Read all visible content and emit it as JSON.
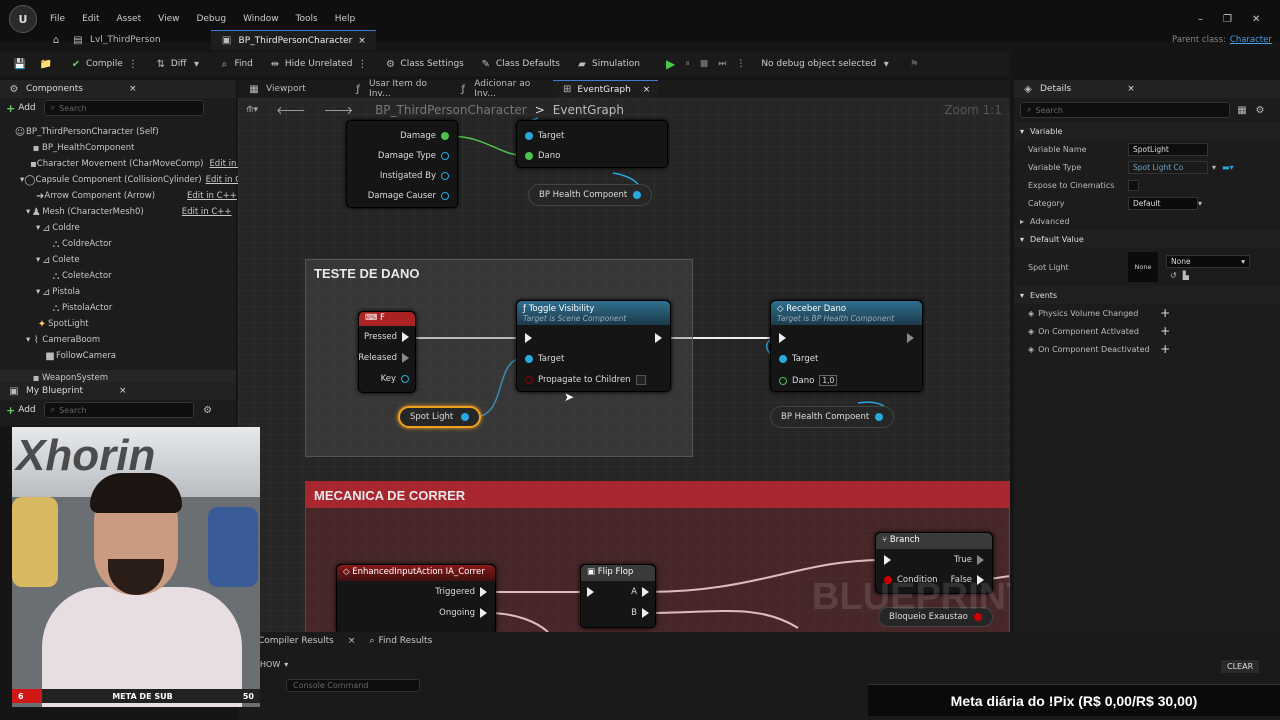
{
  "menu": {
    "items": [
      "File",
      "Edit",
      "Asset",
      "View",
      "Debug",
      "Window",
      "Tools",
      "Help"
    ]
  },
  "tabs": {
    "level": "Lvl_ThirdPerson",
    "blueprint": "BP_ThirdPersonCharacter",
    "close": "×"
  },
  "parent_class": {
    "label": "Parent class:",
    "value": "Character"
  },
  "toolbar": {
    "compile": "Compile",
    "diff": "Diff",
    "find": "Find",
    "hide_unrelated": "Hide Unrelated",
    "class_settings": "Class Settings",
    "class_defaults": "Class Defaults",
    "simulation": "Simulation",
    "debug": "No debug object selected"
  },
  "components": {
    "title": "Components",
    "add": "Add",
    "search_placeholder": "Search",
    "items": [
      {
        "label": "BP_ThirdPersonCharacter (Self)",
        "edit": ""
      },
      {
        "label": "BP_HealthComponent",
        "edit": ""
      },
      {
        "label": "Character Movement (CharMoveComp)",
        "edit": "Edit in C"
      },
      {
        "label": "Capsule Component (CollisionCylinder)",
        "edit": "Edit in C"
      },
      {
        "label": "Arrow Component (Arrow)",
        "edit": "Edit in C++"
      },
      {
        "label": "Mesh (CharacterMesh0)",
        "edit": "Edit in C++"
      },
      {
        "label": "Coldre",
        "edit": ""
      },
      {
        "label": "ColdreActor",
        "edit": ""
      },
      {
        "label": "Colete",
        "edit": ""
      },
      {
        "label": "ColeteActor",
        "edit": ""
      },
      {
        "label": "Pistola",
        "edit": ""
      },
      {
        "label": "PistolaActor",
        "edit": ""
      },
      {
        "label": "SpotLight",
        "edit": ""
      },
      {
        "label": "CameraBoom",
        "edit": ""
      },
      {
        "label": "FollowCamera",
        "edit": ""
      },
      {
        "label": "WeaponSystem",
        "edit": ""
      }
    ]
  },
  "my_blueprint": {
    "title": "My Blueprint",
    "add": "Add",
    "search_placeholder": "Search"
  },
  "graph_tabs": {
    "viewport": "Viewport",
    "func1": "Usar Item do Inv...",
    "func2": "Adicionar ao Inv...",
    "event_graph": "EventGraph"
  },
  "breadcrumb": {
    "root": "BP_ThirdPersonCharacter",
    "sep": ">",
    "current": "EventGraph",
    "zoom": "Zoom 1:1"
  },
  "graph": {
    "top_pins": {
      "damage": "Damage",
      "damage_type": "Damage Type",
      "instigated_by": "Instigated By",
      "damage_causer": "Damage Causer",
      "target": "Target",
      "dano": "Dano",
      "health_comp": "BP Health Compoent"
    },
    "comment_dano": "TESTE DE DANO",
    "f_node": {
      "title": "F",
      "pressed": "Pressed",
      "released": "Released",
      "key": "Key"
    },
    "toggle": {
      "title": "Toggle Visibility",
      "subtitle": "Target is Scene Component",
      "target": "Target",
      "propagate": "Propagate to Children"
    },
    "receber": {
      "title": "Receber Dano",
      "subtitle": "Target is BP Health Component",
      "target": "Target",
      "dano": "Dano",
      "dano_value": "1,0"
    },
    "spot_light": "Spot Light",
    "health_comp2": "BP Health Compoent",
    "comment_correr": "MECANICA DE CORRER",
    "enhanced": {
      "title": "EnhancedInputAction IA_Correr",
      "triggered": "Triggered",
      "ongoing": "Ongoing"
    },
    "flipflop": {
      "title": "Flip Flop",
      "a": "A",
      "b": "B"
    },
    "branch": {
      "title": "Branch",
      "true": "True",
      "false": "False",
      "condition": "Condition"
    },
    "bloqueio": "Bloqueio Exaustao",
    "watermark": "BLUEPRINT"
  },
  "details": {
    "title": "Details",
    "search_placeholder": "Search",
    "variable": "Variable",
    "var_name_label": "Variable Name",
    "var_name": "SpotLight",
    "var_type_label": "Variable Type",
    "var_type": "Spot Light Co",
    "expose_label": "Expose to Cinematics",
    "category_label": "Category",
    "category": "Default",
    "advanced": "Advanced",
    "default_value": "Default Value",
    "spot_light_label": "Spot Light",
    "none_thumb": "None",
    "none": "None",
    "events": "Events",
    "event_items": [
      "Physics Volume Changed",
      "On Component Activated",
      "On Component Deactivated"
    ]
  },
  "bottom": {
    "compiler": "Compiler Results",
    "find_results": "Find Results",
    "show": "HOW",
    "console": "Console Command",
    "clear": "CLEAR"
  },
  "overlay": {
    "sub_count": "6",
    "sub_label": "META DE SUB",
    "sub_goal": "50",
    "banner_text": "Xhorin",
    "pix": "Meta diária do !Pix (R$ 0,00/R$ 30,00)"
  },
  "colors": {
    "accent": "#3a7bd5",
    "exec": "#eeeeee",
    "float_pin": "#6cd66c",
    "object_pin": "#29a8e0",
    "bool_pin": "#8c0000",
    "red_comment": "#a8262d"
  }
}
